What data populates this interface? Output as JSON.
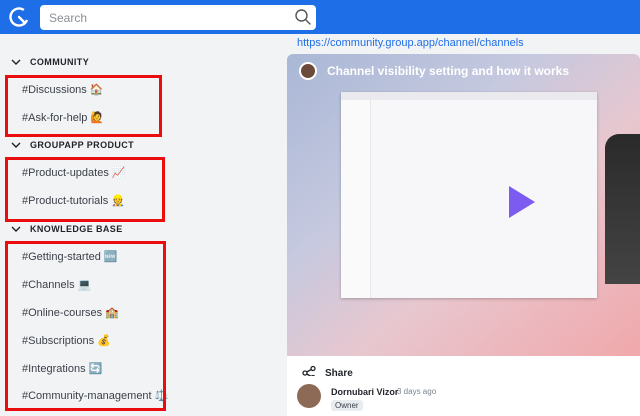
{
  "search": {
    "placeholder": "Search"
  },
  "sidebar": {
    "sections": [
      {
        "title": "COMMUNITY",
        "items": [
          {
            "label": "#Discussions",
            "emoji": "🏠"
          },
          {
            "label": "#Ask-for-help",
            "emoji": "🙋"
          }
        ]
      },
      {
        "title": "GROUPAPP PRODUCT",
        "items": [
          {
            "label": "#Product-updates",
            "emoji": "📈"
          },
          {
            "label": "#Product-tutorials",
            "emoji": "👷"
          }
        ]
      },
      {
        "title": "KNOWLEDGE BASE",
        "items": [
          {
            "label": "#Getting-started",
            "emoji": "🆕"
          },
          {
            "label": "#Channels",
            "emoji": "💻"
          },
          {
            "label": "#Online-courses",
            "emoji": "🏫"
          },
          {
            "label": "#Subscriptions",
            "emoji": "💰"
          },
          {
            "label": "#Integrations",
            "emoji": "🔄"
          },
          {
            "label": "#Community-management",
            "emoji": "⚖️"
          }
        ]
      }
    ]
  },
  "main": {
    "link": "https://community.group.app/channel/channels",
    "video_title": "Channel visibility setting and how it works",
    "share_label": "Share",
    "comment": {
      "author": "Dornubari Vizor",
      "time": "3 days ago",
      "badge": "Owner"
    }
  },
  "colors": {
    "brand": "#1e6ee8",
    "highlight": "#ea0d0d",
    "play": "#7c5cf0"
  }
}
